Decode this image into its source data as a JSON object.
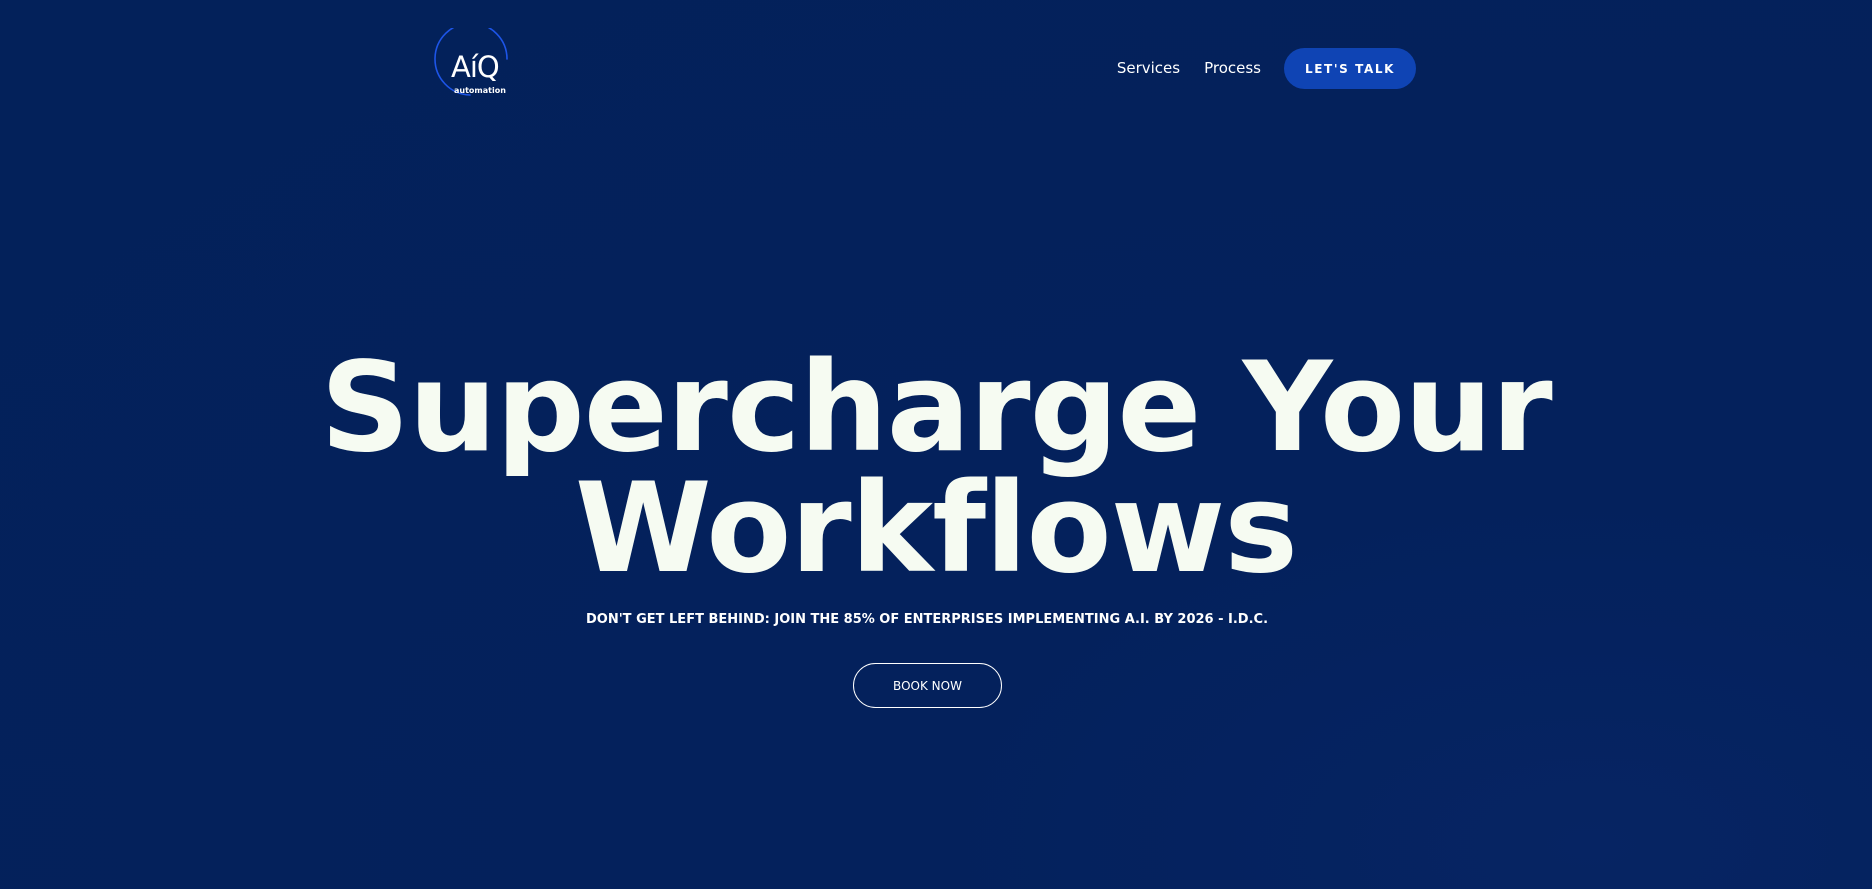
{
  "header": {
    "logo": {
      "wordmark": "AíQ",
      "subtitle": "automation",
      "ring_color": "#1d55e8"
    },
    "nav": {
      "items": [
        {
          "label": "Services"
        },
        {
          "label": "Process"
        }
      ],
      "cta_label": "LET'S TALK"
    }
  },
  "hero": {
    "title_line_1": "Supercharge Your",
    "title_line_2": "Workflows",
    "subtitle": "DON'T GET LEFT BEHIND: JOIN THE 85% OF ENTERPRISES IMPLEMENTING A.I. BY 2026 - I.D.C.",
    "button_label": "BOOK NOW"
  },
  "colors": {
    "background": "#03215a",
    "accent": "#0f44b4",
    "title_text": "#f6fbf2",
    "text": "#ffffff"
  }
}
